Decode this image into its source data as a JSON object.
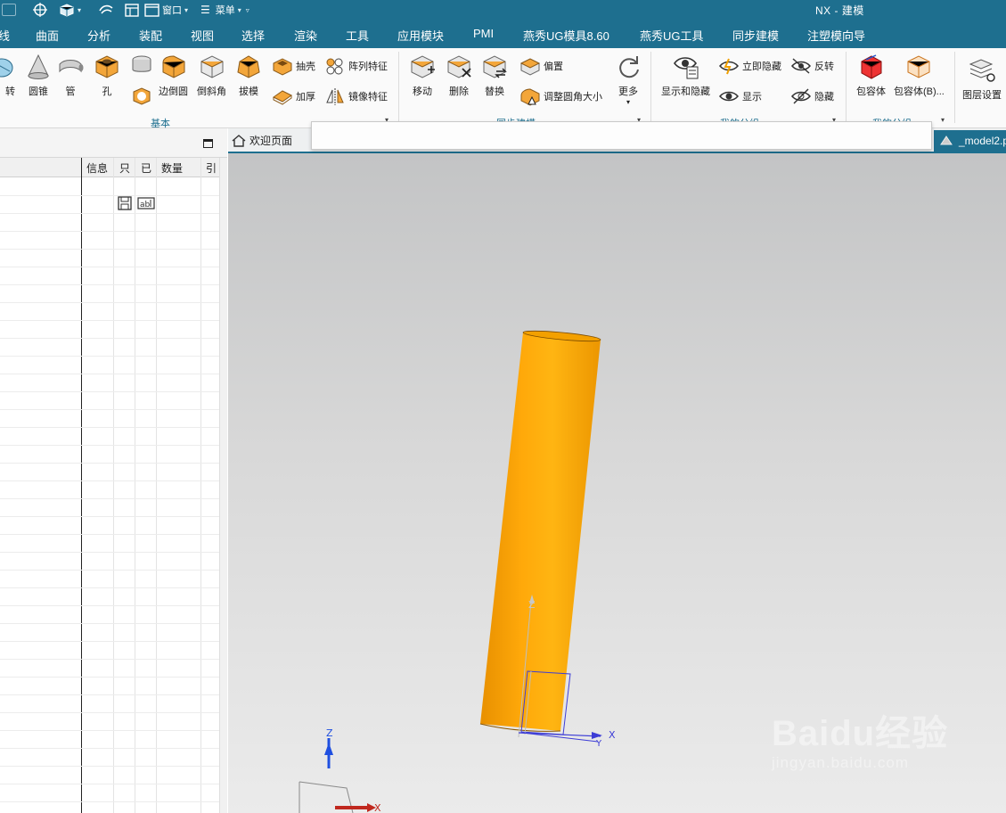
{
  "app": {
    "title": "NX - 建模"
  },
  "quick_access": {
    "window_label": "窗口",
    "menu_label": "菜单"
  },
  "menu_tabs": [
    "线",
    "曲面",
    "分析",
    "装配",
    "视图",
    "选择",
    "渲染",
    "工具",
    "应用模块",
    "PMI",
    "燕秀UG模具8.60",
    "燕秀UG工具",
    "同步建模",
    "注塑模向导"
  ],
  "ribbon": {
    "basic": {
      "label": "基本",
      "buttons": [
        "转",
        "圆锥",
        "管",
        "孔",
        "边倒圆",
        "倒斜角",
        "拔模"
      ],
      "small": [
        "抽壳",
        "阵列特征",
        "加厚",
        "镜像特征"
      ]
    },
    "sync": {
      "label": "同步建模",
      "buttons": [
        "移动",
        "删除",
        "替换",
        "更多"
      ],
      "small": [
        "偏置",
        "调整圆角大小"
      ]
    },
    "my_group1": {
      "label": "我的分组",
      "buttons": [
        "显示和隐藏"
      ],
      "small": [
        "立即隐藏",
        "反转",
        "显示",
        "隐藏"
      ]
    },
    "my_group2": {
      "label": "我的分组",
      "buttons": [
        "包容体",
        "包容体(B)..."
      ]
    },
    "layer": {
      "buttons": [
        "图层设置"
      ]
    }
  },
  "navigator": {
    "columns": [
      "信息",
      "只",
      "已",
      "数量",
      "引"
    ]
  },
  "tabs": {
    "home": "欢迎页面",
    "model": "_model2.p"
  },
  "viewport": {
    "cylinder_color": "#f5a300",
    "axis_labels": {
      "z": "Z",
      "x": "X",
      "y": "Y"
    }
  },
  "watermark": {
    "logo": "Baidu经验",
    "url": "jingyan.baidu.com"
  },
  "colors": {
    "title_bar": "#1e6f8f",
    "ribbon_bg": "#fafafa",
    "group_label": "#1e6f8f"
  }
}
